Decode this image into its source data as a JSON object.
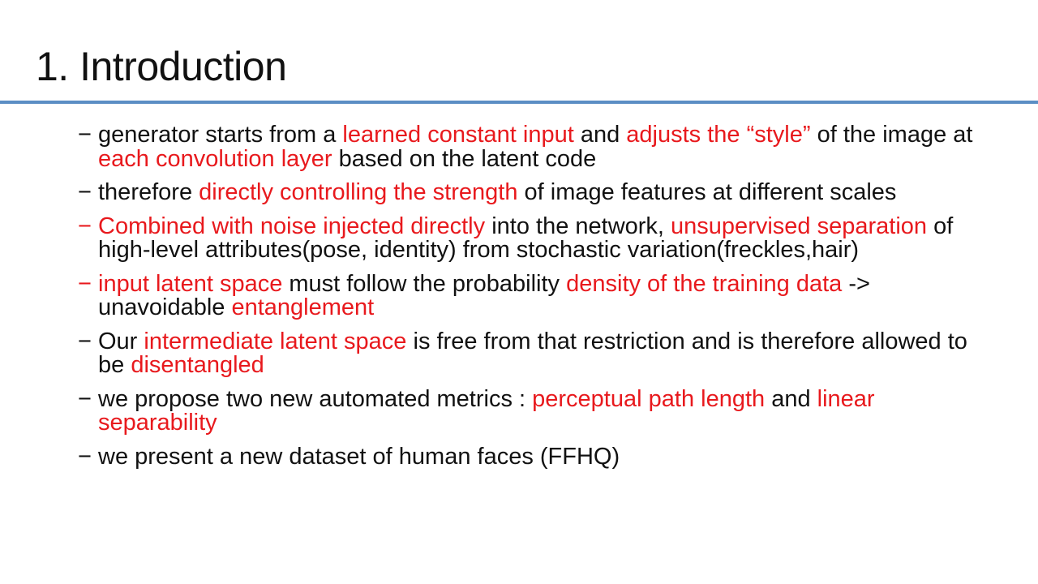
{
  "slide": {
    "title": "1. Introduction",
    "accent_color": "#5b8ec4",
    "highlight_color": "#e8191d"
  },
  "bullets": [
    {
      "marker": "−",
      "marker_red": false,
      "segments": [
        {
          "text": "generator starts from a ",
          "red": false
        },
        {
          "text": "learned constant input",
          "red": true
        },
        {
          "text": " and ",
          "red": false
        },
        {
          "text": "adjusts the “style”",
          "red": true
        },
        {
          "text": " of the image at ",
          "red": false
        },
        {
          "text": "each convolution layer",
          "red": true
        },
        {
          "text": " based on the latent code",
          "red": false
        }
      ]
    },
    {
      "marker": "−",
      "marker_red": false,
      "segments": [
        {
          "text": "therefore ",
          "red": false
        },
        {
          "text": "directly controlling the strength",
          "red": true
        },
        {
          "text": " of image features at different scales",
          "red": false
        }
      ]
    },
    {
      "marker": "−",
      "marker_red": true,
      "segments": [
        {
          "text": "Combined with noise injected directly",
          "red": true
        },
        {
          "text": " into the network, ",
          "red": false
        },
        {
          "text": "unsupervised separation",
          "red": true
        },
        {
          "text": " of high-level attributes(pose, identity) from stochastic variation(freckles,hair)",
          "red": false
        }
      ]
    },
    {
      "marker": "−",
      "marker_red": true,
      "segments": [
        {
          "text": "input latent space",
          "red": true
        },
        {
          "text": " must follow the probability ",
          "red": false
        },
        {
          "text": "density of the training data",
          "red": true
        },
        {
          "text": " -> unavoidable ",
          "red": false
        },
        {
          "text": "entanglement",
          "red": true
        }
      ]
    },
    {
      "marker": "−",
      "marker_red": false,
      "segments": [
        {
          "text": "Our ",
          "red": false
        },
        {
          "text": "intermediate latent space",
          "red": true
        },
        {
          "text": " is free from that restriction and is therefore allowed to be ",
          "red": false
        },
        {
          "text": "disentangled",
          "red": true
        }
      ]
    },
    {
      "marker": "−",
      "marker_red": false,
      "segments": [
        {
          "text": "we propose two new automated metrics : ",
          "red": false
        },
        {
          "text": "perceptual path length",
          "red": true
        },
        {
          "text": " and ",
          "red": false
        },
        {
          "text": "linear separability",
          "red": true
        }
      ]
    },
    {
      "marker": "−",
      "marker_red": false,
      "segments": [
        {
          "text": "we present a new dataset of human faces (FFHQ)",
          "red": false
        }
      ]
    }
  ]
}
